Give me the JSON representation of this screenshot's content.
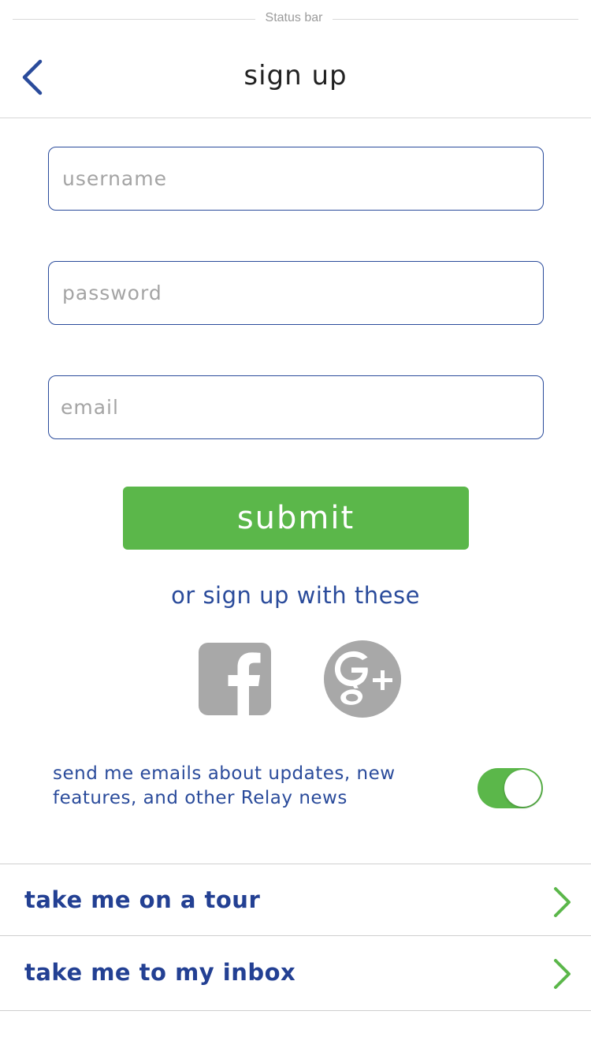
{
  "status_bar": {
    "label": "Status bar"
  },
  "nav": {
    "title": "sign up",
    "back_icon": "chevron-left-icon"
  },
  "form": {
    "username_placeholder": "username",
    "password_placeholder": "password",
    "email_placeholder": "email",
    "submit_label": "submit"
  },
  "social": {
    "caption": "or sign up with these",
    "providers": [
      {
        "name": "facebook",
        "icon": "facebook-icon"
      },
      {
        "name": "google-plus",
        "icon": "google-plus-icon"
      }
    ]
  },
  "optin": {
    "line1": "send me emails about updates, new",
    "line2": "features, and other Relay news",
    "enabled": true
  },
  "links": {
    "tour_label": "take me on a tour",
    "inbox_label": "take me to my inbox"
  },
  "colors": {
    "brand_blue": "#2a4b9b",
    "accent_green": "#5bb74a",
    "social_gray": "#a8a8a8"
  }
}
